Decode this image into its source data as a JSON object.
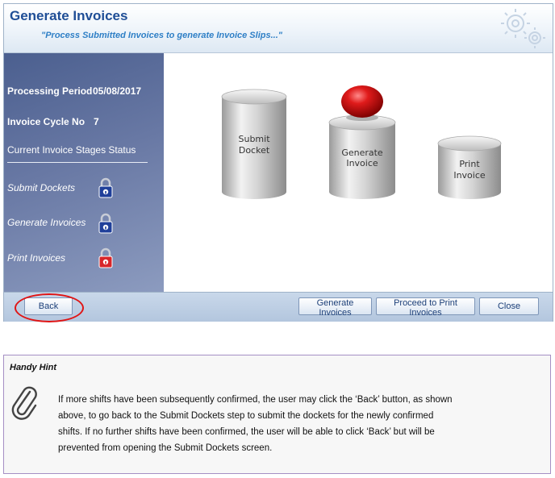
{
  "window": {
    "title": "Generate Invoices",
    "subtitle": "\"Process Submitted Invoices to generate Invoice Slips...\""
  },
  "sidebar": {
    "processing_period_label": "Processing Period",
    "processing_period_value": "05/08/2017",
    "invoice_cycle_label": "Invoice Cycle No",
    "invoice_cycle_value": "7",
    "status_heading": "Current Invoice Stages Status",
    "stages": [
      {
        "label": "Submit Dockets",
        "lock_color": "#1f3f9a"
      },
      {
        "label": "Generate Invoices",
        "lock_color": "#1f3f9a"
      },
      {
        "label": "Print Invoices",
        "lock_color": "#d8262a"
      }
    ]
  },
  "diagram": {
    "cylinders": [
      {
        "line1": "Submit",
        "line2": "Docket"
      },
      {
        "line1": "Generate",
        "line2": "Invoice"
      },
      {
        "line1": "Print",
        "line2": "Invoice"
      }
    ],
    "active_indicator_color": "#d0141b"
  },
  "buttons": {
    "back": "Back",
    "generate": "Generate Invoices",
    "proceed": "Proceed to Print Invoices",
    "close": "Close"
  },
  "hint": {
    "title": "Handy Hint",
    "lines": [
      "If more shifts have been subsequently confirmed, the user may click the ‘Back’ button, as shown",
      "above, to go back to the Submit Dockets step to submit the dockets for the newly confirmed",
      "shifts. If no further shifts have been confirmed, the user will be able to click ‘Back’ but will be",
      "prevented from opening the Submit Dockets screen."
    ]
  }
}
